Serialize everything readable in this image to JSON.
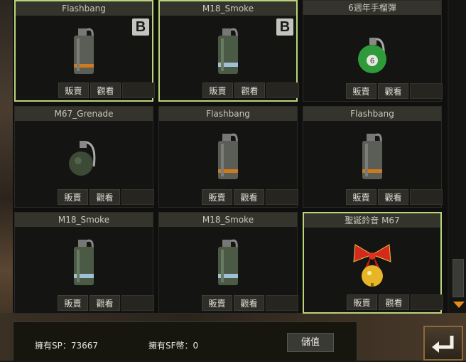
{
  "items": [
    {
      "name": "Flashbang",
      "icon": "flashbang-grenade-icon",
      "badge": "B",
      "selected": true
    },
    {
      "name": "M18_Smoke",
      "icon": "smoke-grenade-icon",
      "badge": "B",
      "selected": true
    },
    {
      "name": "6週年手榴彈",
      "icon": "anniversary-grenade-icon",
      "badge": null,
      "selected": false
    },
    {
      "name": "M67_Grenade",
      "icon": "frag-grenade-icon",
      "badge": null,
      "selected": false
    },
    {
      "name": "Flashbang",
      "icon": "flashbang-grenade-icon",
      "badge": null,
      "selected": false
    },
    {
      "name": "Flashbang",
      "icon": "flashbang-grenade-icon",
      "badge": null,
      "selected": false
    },
    {
      "name": "M18_Smoke",
      "icon": "smoke-grenade-icon",
      "badge": null,
      "selected": false
    },
    {
      "name": "M18_Smoke",
      "icon": "smoke-grenade-icon",
      "badge": null,
      "selected": false
    },
    {
      "name": "聖誕鈴音 M67",
      "icon": "christmas-bell-grenade-icon",
      "badge": null,
      "selected": true
    }
  ],
  "buttons": {
    "sell": "販賣",
    "view": "觀看"
  },
  "footer": {
    "sp_label": "擁有SP：73667",
    "sf_label": "擁有SF幣：0",
    "charge_label": "儲值"
  },
  "icons": {
    "scroll_down": "scroll-down-arrow-icon",
    "return": "return-arrow-icon"
  },
  "colors": {
    "selected_border": "#b9d47a",
    "scroll_arrow": "#e88a1a"
  }
}
